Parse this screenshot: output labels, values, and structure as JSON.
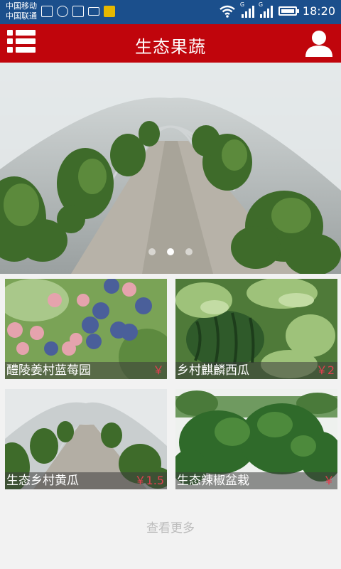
{
  "status_bar": {
    "carrier_1": "中国移动",
    "carrier_2": "中国联通",
    "network_1": "G",
    "network_2": "G",
    "time": "18:20",
    "icons": [
      "sim-icon",
      "shield-icon",
      "image-icon",
      "keyboard-icon",
      "star-app-icon",
      "wifi-icon",
      "signal-icon",
      "battery-icon"
    ]
  },
  "header": {
    "title": "生态果蔬",
    "menu_icon": "list-menu-icon",
    "user_icon": "user-icon",
    "background": "#c0050c"
  },
  "banner": {
    "slide_count": 3,
    "active_slide": 2,
    "image": "greenhouse-cucumber-photo"
  },
  "products": [
    {
      "name": "醴陵姜村蓝莓园",
      "price": "￥",
      "image": "blueberry-photo"
    },
    {
      "name": "乡村麒麟西瓜",
      "price": "￥2",
      "image": "watermelon-photo"
    },
    {
      "name": "生态乡村黄瓜",
      "price": "￥1.5",
      "image": "cucumber-greenhouse-photo"
    },
    {
      "name": "生态辣椒盆栽",
      "price": "￥",
      "image": "pepper-plant-photo"
    }
  ],
  "more_label": "查看更多",
  "colors": {
    "price": "#e04050",
    "status_bar": "#1b4f8c"
  }
}
